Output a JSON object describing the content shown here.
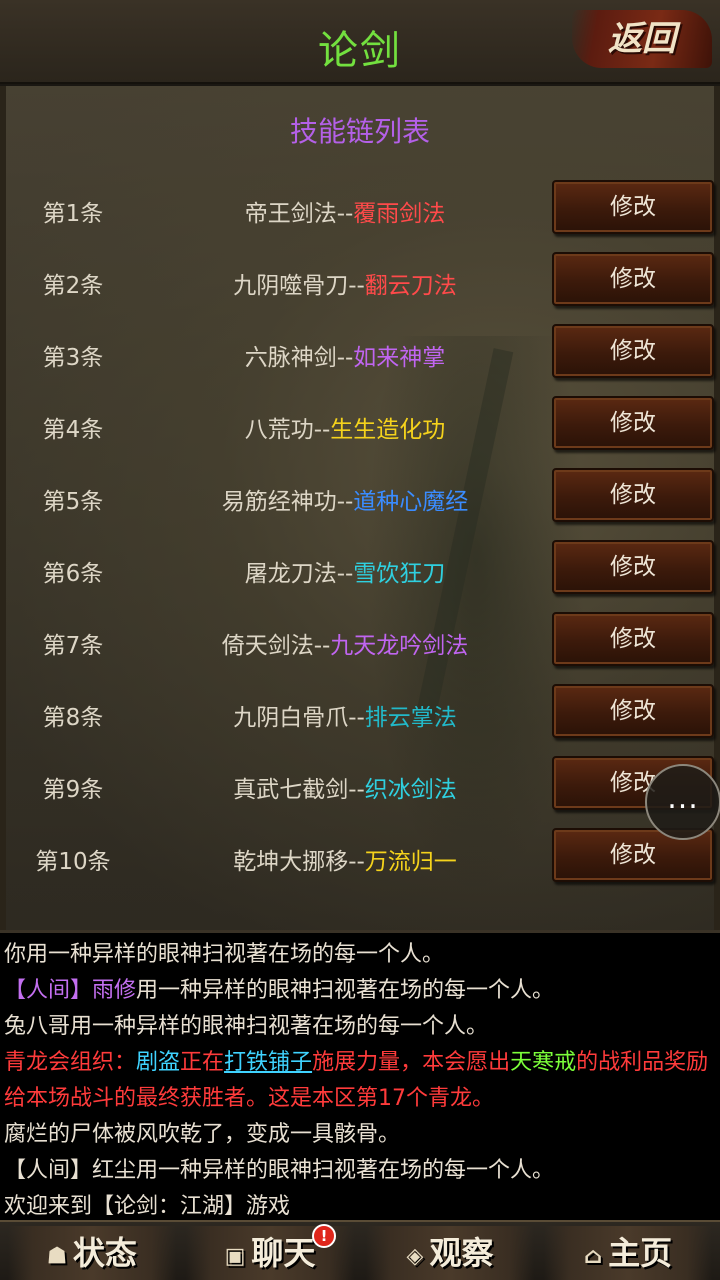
{
  "header": {
    "title": "论剑",
    "back_label": "返回"
  },
  "list": {
    "title": "技能链列表",
    "edit_label": "修改",
    "rows": [
      {
        "index": "第1条",
        "first": "帝王剑法",
        "sep": "--",
        "second": "覆雨剑法",
        "second_color": "#ff4a4a"
      },
      {
        "index": "第2条",
        "first": "九阴噬骨刀",
        "sep": "--",
        "second": "翻云刀法",
        "second_color": "#ff4a4a"
      },
      {
        "index": "第3条",
        "first": "六脉神剑",
        "sep": "--",
        "second": "如来神掌",
        "second_color": "#c065f0"
      },
      {
        "index": "第4条",
        "first": "八荒功",
        "sep": "--",
        "second": "生生造化功",
        "second_color": "#f5d31c"
      },
      {
        "index": "第5条",
        "first": "易筋经神功",
        "sep": "--",
        "second": "道种心魔经",
        "second_color": "#3a8cff"
      },
      {
        "index": "第6条",
        "first": "屠龙刀法",
        "sep": "--",
        "second": "雪饮狂刀",
        "second_color": "#2fd0e0"
      },
      {
        "index": "第7条",
        "first": "倚天剑法",
        "sep": "--",
        "second": "九天龙吟剑法",
        "second_color": "#c065f0"
      },
      {
        "index": "第8条",
        "first": "九阴白骨爪",
        "sep": "--",
        "second": "排云掌法",
        "second_color": "#22b9c9"
      },
      {
        "index": "第9条",
        "first": "真武七截剑",
        "sep": "--",
        "second": "织冰剑法",
        "second_color": "#2fd0e0"
      },
      {
        "index": "第10条",
        "first": "乾坤大挪移",
        "sep": "--",
        "second": "万流归一",
        "second_color": "#f5d31c"
      }
    ]
  },
  "float_menu": {
    "label": "..."
  },
  "chat": {
    "line1": "你用一种异样的眼神扫视著在场的每一个人。",
    "line2_channel": "【人间】",
    "line2_name": "雨修",
    "line2_text": "用一种异样的眼神扫视著在场的每一个人。",
    "line3": "兔八哥用一种异样的眼神扫视著在场的每一个人。",
    "line4_a": "青龙会组织：",
    "line4_b": "剧盗",
    "line4_c": "正在",
    "line4_d": "打铁铺子",
    "line4_e": "施展力量，本会愿出",
    "line4_f": "天寒戒",
    "line4_g": "的战利品奖励给本场战斗的最终获胜者。这是本区第17个青龙。",
    "line5": "腐烂的尸体被风吹乾了，变成一具骸骨。",
    "line6": "【人间】红尘用一种异样的眼神扫视著在场的每一个人。",
    "line7": "欢迎来到【论剑：江湖】游戏"
  },
  "tabs": {
    "status": "状态",
    "chat": "聊天",
    "chat_badge": "!",
    "observe": "观察",
    "home": "主页"
  }
}
